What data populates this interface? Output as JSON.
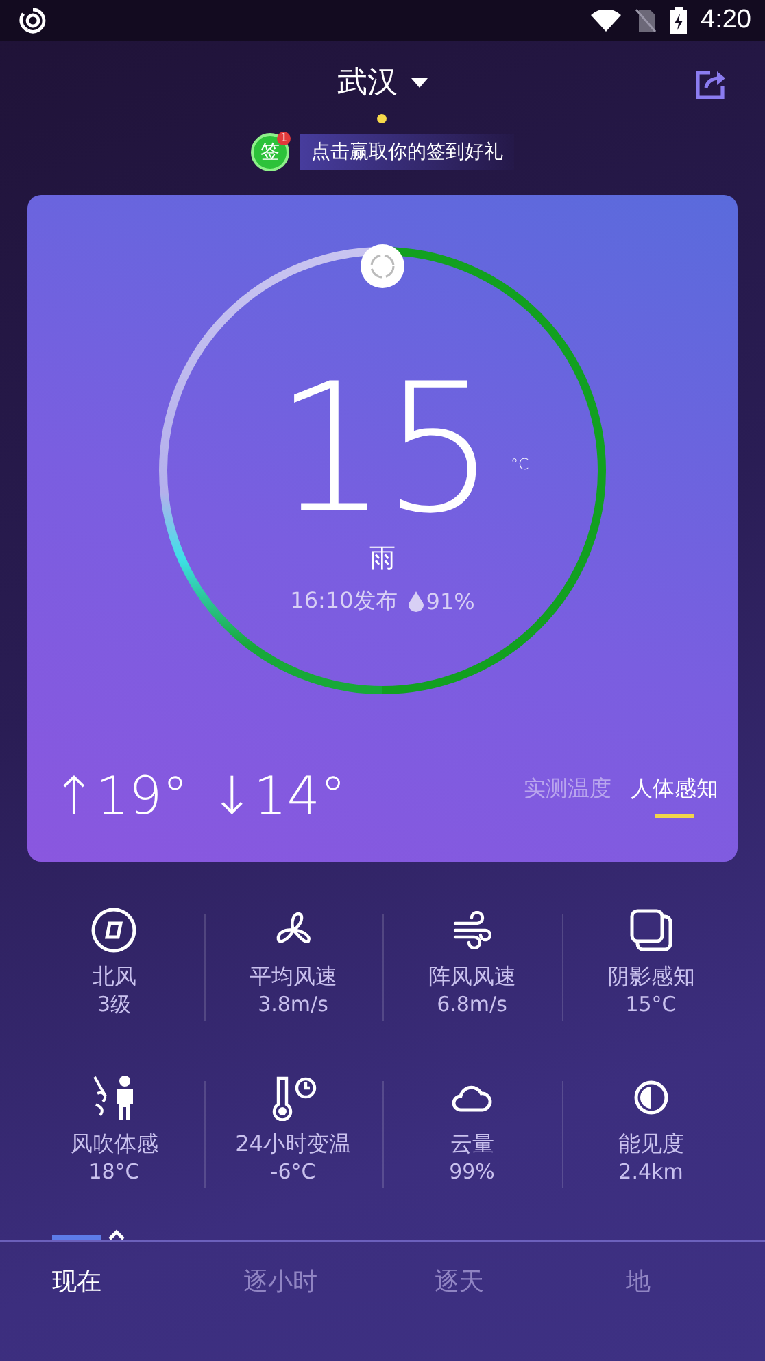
{
  "status_bar": {
    "time": "4:20"
  },
  "header": {
    "city": "武汉",
    "signin_badge": "签",
    "signin_count": "1",
    "signin_text": "点击赢取你的签到好礼"
  },
  "current": {
    "temperature": "15",
    "unit": "°C",
    "condition": "雨",
    "published": "16:10发布",
    "humidity": "91%",
    "high": "↑19°",
    "low": "↓14°",
    "modes": [
      {
        "label": "实测温度",
        "selected": false
      },
      {
        "label": "人体感知",
        "selected": true
      }
    ]
  },
  "details": [
    {
      "kind": "compass",
      "label": "北风",
      "value": "3级"
    },
    {
      "kind": "fan",
      "label": "平均风速",
      "value": "3.8m/s"
    },
    {
      "kind": "wind",
      "label": "阵风风速",
      "value": "6.8m/s"
    },
    {
      "kind": "shade",
      "label": "阴影感知",
      "value": "15°C"
    },
    {
      "kind": "person",
      "label": "风吹体感",
      "value": "18°C"
    },
    {
      "kind": "thermo",
      "label": "24小时变温",
      "value": "-6°C"
    },
    {
      "kind": "cloud",
      "label": "云量",
      "value": "99%"
    },
    {
      "kind": "contrast",
      "label": "能见度",
      "value": "2.4km"
    }
  ],
  "bottom_tabs": [
    {
      "label": "现在",
      "selected": true
    },
    {
      "label": "逐小时",
      "selected": false
    },
    {
      "label": "逐天",
      "selected": false
    },
    {
      "label": "地",
      "selected": false
    }
  ]
}
